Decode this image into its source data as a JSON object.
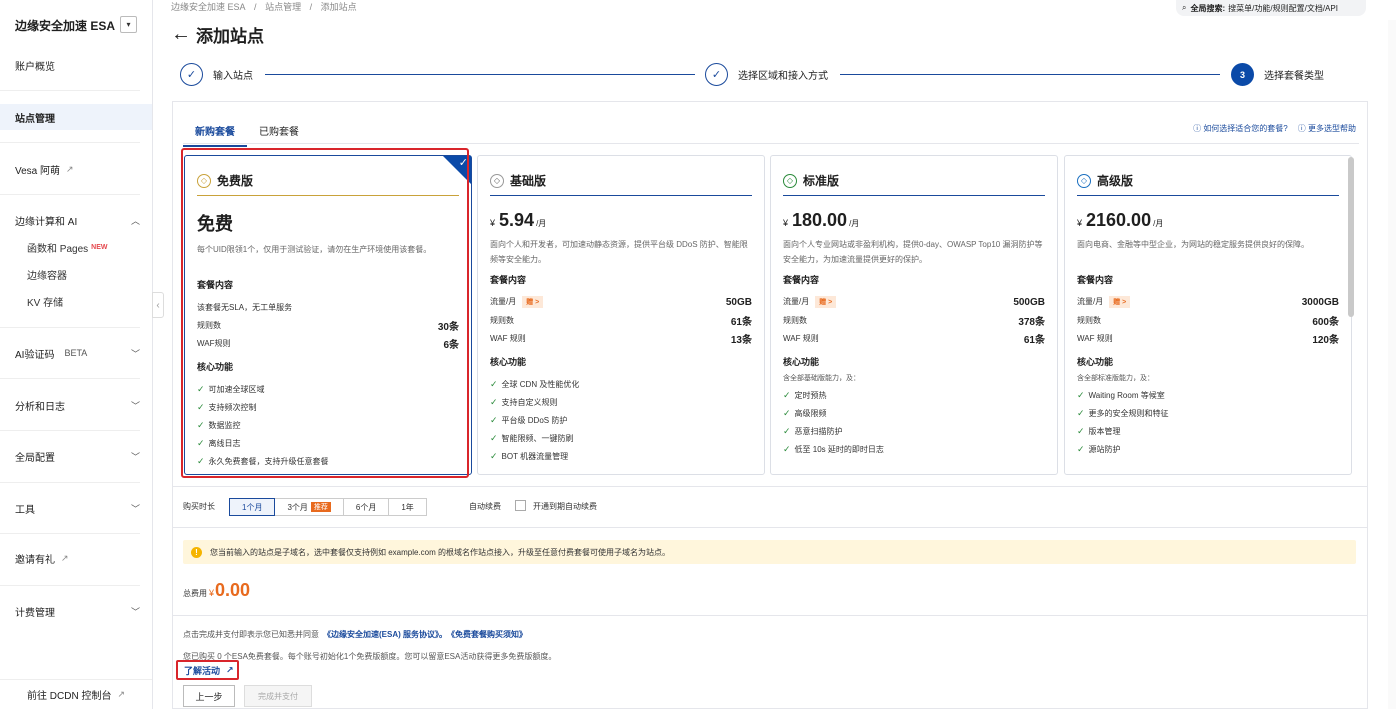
{
  "sidebar": {
    "title": "边缘安全加速 ESA",
    "overview": "账户概览",
    "site_mgmt": "站点管理",
    "vesa": "Vesa 阿萌",
    "edge_ai": "边缘计算和 AI",
    "functions_pages": "函数和 Pages",
    "new_tag": "NEW",
    "edge_container": "边缘容器",
    "kv": "KV 存储",
    "ai_captcha": "AI验证码",
    "beta_tag": "BETA",
    "analytics": "分析和日志",
    "global_config": "全局配置",
    "tools": "工具",
    "invite": "邀请有礼",
    "billing": "计费管理",
    "dcdn": "前往 DCDN 控制台"
  },
  "breadcrumb": [
    "边缘安全加速 ESA",
    "/",
    "站点管理",
    "/",
    "添加站点"
  ],
  "global_search": {
    "label": "全局搜索:",
    "hint": "搜菜单/功能/规则配置/文档/API"
  },
  "page_title": "添加站点",
  "steps": [
    "输入站点",
    "选择区域和接入方式",
    "选择套餐类型"
  ],
  "current_step_number": "3",
  "tabs": [
    "新购套餐",
    "已购套餐"
  ],
  "help_links": [
    "如何选择适合您的套餐?",
    "更多选型帮助"
  ],
  "plans": [
    {
      "name": "免费版",
      "price_text": "免费",
      "desc": "每个UID限领1个，仅用于测试验证，请勿在生产环境使用该套餐。",
      "content_title": "套餐内容",
      "rows": [
        {
          "label": "该套餐无SLA，无工单服务",
          "value": ""
        },
        {
          "label": "规则数",
          "value": "30条"
        },
        {
          "label": "WAF规则",
          "value": "6条"
        }
      ],
      "core_title": "核心功能",
      "feature_note": "",
      "features": [
        "可加速全球区域",
        "支持频次控制",
        "数据监控",
        "离线日志",
        "永久免费套餐，支持升级任意套餐"
      ]
    },
    {
      "name": "基础版",
      "currency": "¥",
      "price": "5.94",
      "unit": "/月",
      "desc": "面向个人和开发者，可加速动静态资源，提供平台级 DDoS 防护、智能限频等安全能力。",
      "content_title": "套餐内容",
      "traffic_label": "流量/月",
      "gift": "赠 >",
      "traffic": "50GB",
      "rows": [
        {
          "label": "规则数",
          "value": "61条"
        },
        {
          "label": "WAF 规则",
          "value": "13条"
        }
      ],
      "core_title": "核心功能",
      "feature_note": "",
      "features": [
        "全球 CDN 及性能优化",
        "支持自定义规则",
        "平台级 DDoS 防护",
        "智能限频、一键防刷",
        "BOT 机器流量管理"
      ]
    },
    {
      "name": "标准版",
      "currency": "¥",
      "price": "180.00",
      "unit": "/月",
      "desc": "面向个人专业网站或非盈利机构，提供0-day、OWASP Top10 漏洞防护等安全能力，为加速流量提供更好的保护。",
      "content_title": "套餐内容",
      "traffic_label": "流量/月",
      "gift": "赠 >",
      "traffic": "500GB",
      "rows": [
        {
          "label": "规则数",
          "value": "378条"
        },
        {
          "label": "WAF 规则",
          "value": "61条"
        }
      ],
      "core_title": "核心功能",
      "feature_note": "含全部基础版能力，及：",
      "features": [
        "定时预热",
        "高级限频",
        "恶意扫描防护",
        "低至 10s 延时的即时日志"
      ]
    },
    {
      "name": "高级版",
      "currency": "¥",
      "price": "2160.00",
      "unit": "/月",
      "desc": "面向电商、金融等中型企业，为网站的稳定服务提供良好的保障。",
      "content_title": "套餐内容",
      "traffic_label": "流量/月",
      "gift": "赠 >",
      "traffic": "3000GB",
      "rows": [
        {
          "label": "规则数",
          "value": "600条"
        },
        {
          "label": "WAF 规则",
          "value": "120条"
        }
      ],
      "core_title": "核心功能",
      "feature_note": "含全部标准版能力，及：",
      "features": [
        "Waiting Room 等候室",
        "更多的安全规则和特征",
        "版本管理",
        "源站防护"
      ]
    }
  ],
  "duration": {
    "label": "购买时长",
    "options": [
      "1个月",
      "3个月",
      "6个月",
      "1年"
    ],
    "recommend": "推荐",
    "selected": "1个月"
  },
  "auto_renew": {
    "label": "自动续费",
    "text": "开通到期自动续费"
  },
  "notice": "您当前输入的站点是子域名，选中套餐仅支持例如 example.com 的根域名作站点接入，升级至任意付费套餐可使用子域名为站点。",
  "total": {
    "label": "总费用",
    "currency": "¥",
    "amount": "0.00"
  },
  "agreement": {
    "text": "点击完成并支付即表示您已知悉并同意",
    "link1": "《边缘安全加速(ESA) 服务协议》。",
    "link2": "《免费套餐购买须知》"
  },
  "quota_text": "您已购买 0 个ESA免费套餐。每个账号初始化1个免费版额度。您可以留意ESA活动获得更多免费版额度。",
  "learn_link": "了解活动",
  "buttons": {
    "prev": "上一步",
    "pay": "完成并支付"
  }
}
